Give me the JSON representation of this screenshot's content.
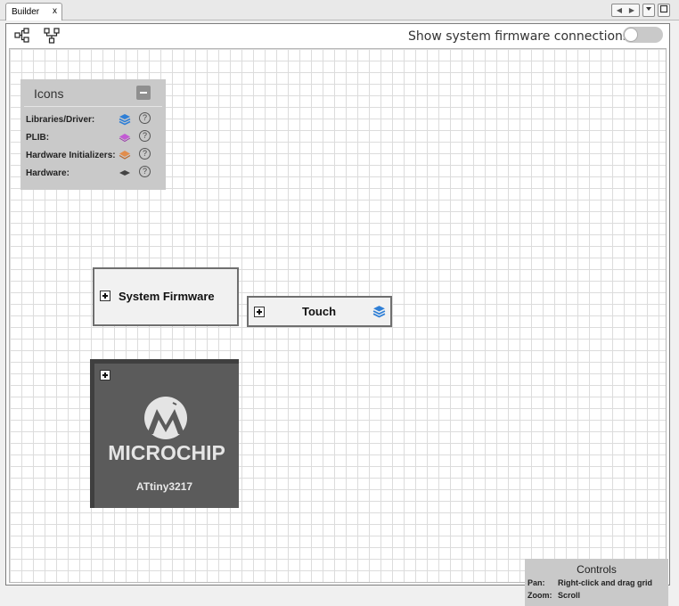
{
  "tab": {
    "label": "Builder",
    "close": "x"
  },
  "window_controls": {
    "prev": "◀",
    "next": "▶",
    "minimize": "",
    "maximize": ""
  },
  "toolbar": {
    "toggle_label": "Show system firmware connections",
    "toggle_on": false
  },
  "legend": {
    "title": "Icons",
    "rows": [
      {
        "label": "Libraries/Driver:",
        "icon": "stack-layers-icon",
        "color": "#2f7fd6"
      },
      {
        "label": "PLIB:",
        "icon": "diamond-layer-icon",
        "color": "#c25bd3"
      },
      {
        "label": "Hardware Initializers:",
        "icon": "diamond-layer-icon",
        "color": "#e28d4c"
      },
      {
        "label": "Hardware:",
        "icon": "diamond-layer-icon",
        "color": "#444444"
      }
    ],
    "help_glyph": "?"
  },
  "nodes": {
    "system_firmware": "System Firmware",
    "touch": "Touch"
  },
  "chip": {
    "brand": "MICROCHIP",
    "part": "ATtiny3217"
  },
  "controls": {
    "title": "Controls",
    "pan_key": "Pan:",
    "pan_value": "Right-click and drag grid",
    "zoom_key": "Zoom:",
    "zoom_value": "Scroll"
  }
}
